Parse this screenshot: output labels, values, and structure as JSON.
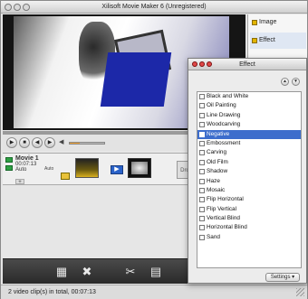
{
  "window": {
    "title": "Xilisoft Movie Maker 6 (Unregistered)"
  },
  "side_panel": {
    "items": [
      {
        "label": "Image"
      },
      {
        "label": "Effect"
      }
    ]
  },
  "effect_window": {
    "title": "Effect",
    "effects": [
      "Black and White",
      "Oil Painting",
      "Line Drawing",
      "Woodcarving",
      "Negative",
      "Embossment",
      "Carving",
      "Old Film",
      "Shadow",
      "Haze",
      "Mosaic",
      "Flip Horizontal",
      "Flip Vertical",
      "Vertical Blind",
      "Horizontal Blind",
      "Sand"
    ],
    "selected_index": 4,
    "settings_label": "Settings"
  },
  "timeline": {
    "movie_name": "Movie 1",
    "duration": "00:07:13",
    "mode": "Auto",
    "mode2": "Auto",
    "drop_label": "Dro",
    "add_label": "+"
  },
  "controls": {
    "volume_fraction": 0.3
  },
  "status": {
    "text": "2 video clip(s) in total, 00:07:13"
  },
  "icons": {
    "play": "play-icon",
    "stop": "stop-icon",
    "prev": "prev-frame-icon",
    "next": "next-frame-icon",
    "volume": "volume-icon",
    "add_clip": "add-clip-icon",
    "delete": "delete-icon",
    "split": "split-icon",
    "edit": "edit-clip-icon"
  },
  "colors": {
    "accent": "#f0a030",
    "selection": "#3d6dcc",
    "close": "#e04848"
  }
}
